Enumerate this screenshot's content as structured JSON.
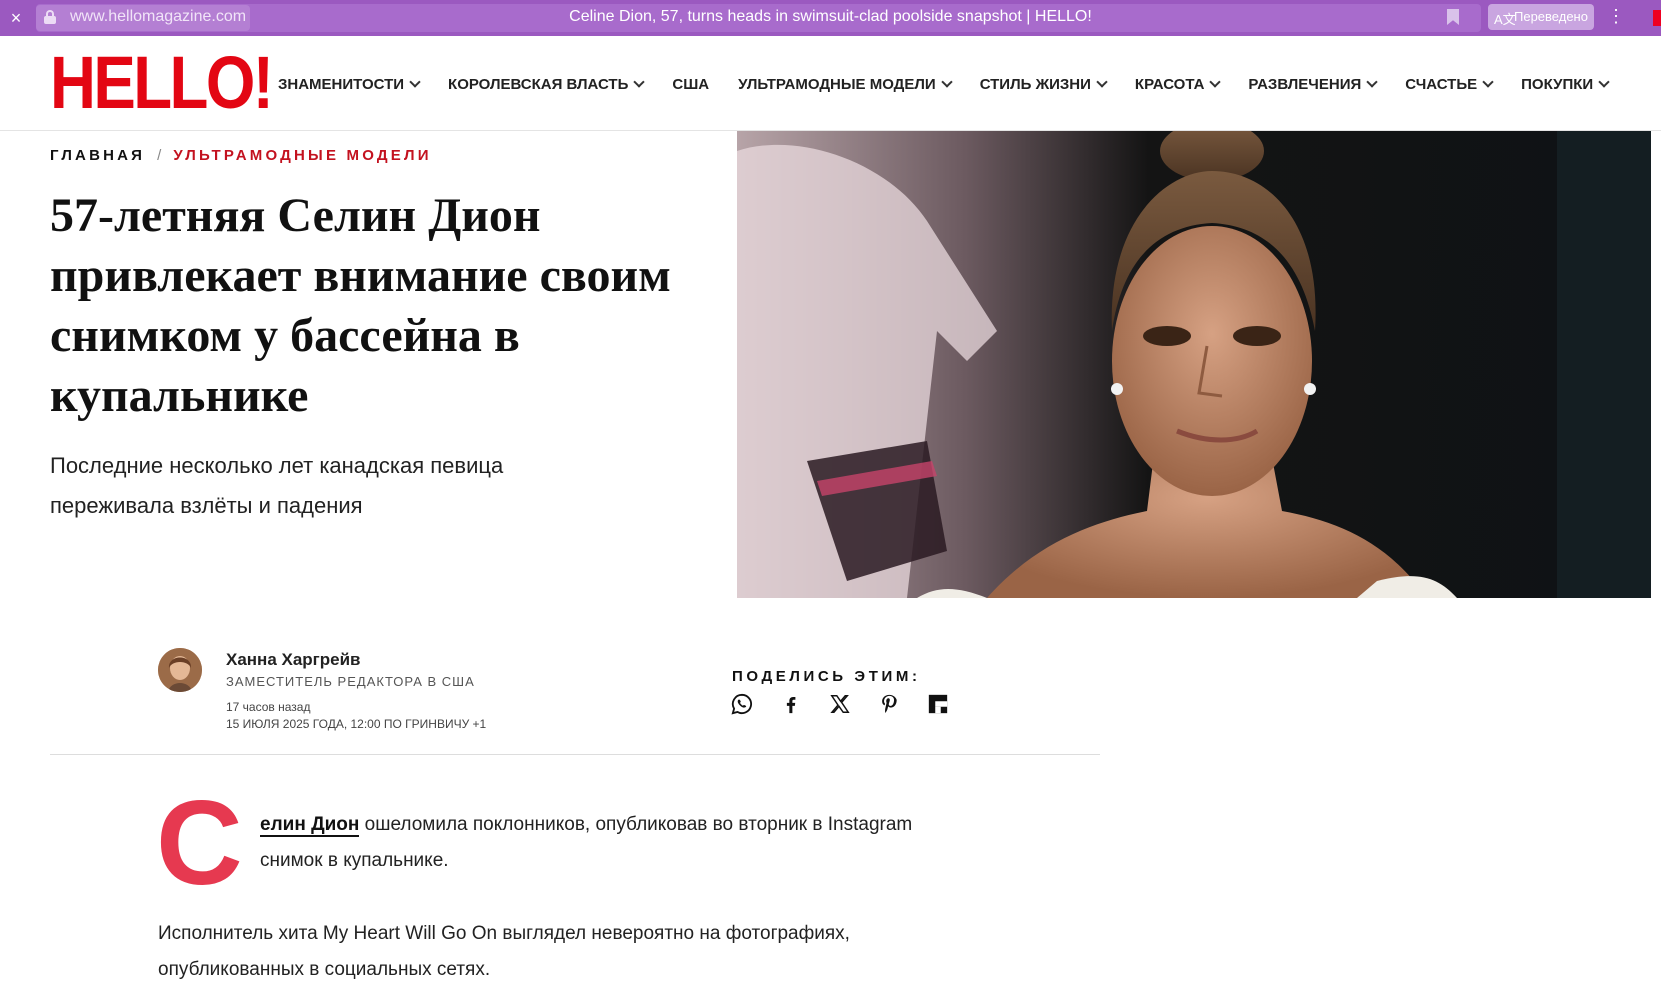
{
  "browser": {
    "url": "www.hellomagazine.com",
    "tab_title": "Celine Dion, 57, turns heads in swimsuit-clad poolside snapshot | HELLO!",
    "translated_label": "Переведено",
    "close_glyph": "×",
    "menu_glyph": "⋮"
  },
  "site": {
    "logo_text": "HELLO!",
    "brand_color": "#e30613",
    "nav": [
      {
        "label": "ЗНАМЕНИТОСТИ",
        "has_dropdown": true
      },
      {
        "label": "КОРОЛЕВСКАЯ ВЛАСТЬ",
        "has_dropdown": true
      },
      {
        "label": "США",
        "has_dropdown": false
      },
      {
        "label": "УЛЬТРАМОДНЫЕ МОДЕЛИ",
        "has_dropdown": true
      },
      {
        "label": "СТИЛЬ ЖИЗНИ",
        "has_dropdown": true
      },
      {
        "label": "КРАСОТА",
        "has_dropdown": true
      },
      {
        "label": "РАЗВЛЕЧЕНИЯ",
        "has_dropdown": true
      },
      {
        "label": "СЧАСТЬЕ",
        "has_dropdown": true
      },
      {
        "label": "ПОКУПКИ",
        "has_dropdown": true
      }
    ]
  },
  "article": {
    "breadcrumb": {
      "home": "ГЛАВНАЯ",
      "separator": "/",
      "category": "УЛЬТРАМОДНЫЕ МОДЕЛИ"
    },
    "headline": "57-летняя Селин Дион привлекает внимание своим снимком у бассейна в купальнике",
    "subheadline": "Последние несколько лет канадская певица переживала взлёты и падения",
    "author": {
      "name": "Ханна Харгрейв",
      "role": "ЗАМЕСТИТЕЛЬ РЕДАКТОРА В США",
      "time_ago": "17 часов назад",
      "published": "15 ИЮЛЯ 2025 ГОДА, 12:00 ПО ГРИНВИЧУ +1"
    },
    "share": {
      "label": "ПОДЕЛИСЬ ЭТИМ:",
      "icons": [
        "whatsapp-icon",
        "facebook-icon",
        "x-icon",
        "pinterest-icon",
        "flipboard-icon"
      ]
    },
    "dropcap": "С",
    "para1_link": "елин Дион",
    "para1_rest": " ошеломила поклонников, опубликовав во вторник в Instagram снимок в купальнике.",
    "para2": "Исполнитель хита My Heart Will Go On выглядел невероятно на фотографиях, опубликованных в социальных сетях.",
    "accent_color": "#c3121f",
    "dropcap_color": "#e63950"
  }
}
